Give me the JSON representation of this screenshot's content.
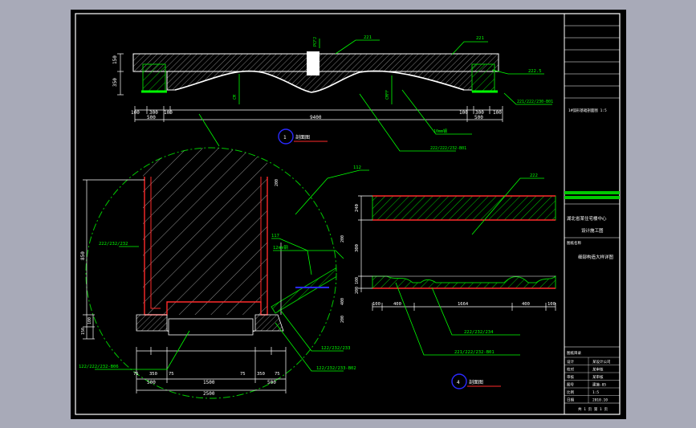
{
  "drawing": {
    "background": "#000000",
    "colors": {
      "border": "#ffffff",
      "dim": "#ffffff",
      "leader": "#00ff00",
      "wall": "#ff2a2a",
      "section_line": "#ff2a2a",
      "hatch_green": "#00c800",
      "hatch_white": "#bbbbbb",
      "blue_mark": "#2a2aff",
      "center_line": "#00c800"
    },
    "elevation": {
      "leader_labels": [
        "221",
        "221",
        "222.5",
        "PCFJ",
        "221/222/230-B01",
        "CM",
        "10mm钢",
        "CMFF",
        "222/222/232-B01"
      ],
      "dims_bottom": [
        "100",
        "300",
        "100",
        "100",
        "300",
        "100"
      ],
      "dims_bottom2": [
        "500",
        "9400",
        "500"
      ],
      "dims_left": [
        "150",
        "350"
      ],
      "title_number": "1",
      "title_text": "剖面图"
    },
    "detail": {
      "leader_labels": [
        "112",
        "117",
        "12mm钢",
        "122/232/233",
        "122/232/233-B02",
        "122/222/232-B06"
      ],
      "dims_left": [
        "850",
        "100",
        "150"
      ],
      "dims_right": [
        "200",
        "200",
        "400",
        "200"
      ],
      "dims_bottom": [
        "75",
        "350",
        "75",
        "75",
        "350",
        "75"
      ],
      "dims_bottom2": [
        "500",
        "1500",
        "500"
      ],
      "dims_bottom3": [
        "2500"
      ],
      "left_label": "222/232/232"
    },
    "section": {
      "leader_labels": [
        "222",
        "222/232/234",
        "221/222/232-B01"
      ],
      "dims_left": [
        "240",
        "300",
        "100",
        "200"
      ],
      "dims_bottom": [
        "100",
        "400",
        "1664",
        "400",
        "100"
      ],
      "title_number": "4",
      "title_text": "剖面图"
    },
    "title_block": {
      "note_small": "1#弧形基础剖面图 1:5",
      "project_name": "湖北省某住宅楼中心",
      "project_sub": "设计施工图",
      "drawing_no_label": "图纸名称",
      "drawing_name": "细部构造大样详图",
      "sheet_label": "图纸目录",
      "rows": [
        [
          "设计",
          "某设计公司"
        ],
        [
          "校对",
          "某审核"
        ],
        [
          "审核",
          "某审核"
        ],
        [
          "图号",
          "建施-05"
        ],
        [
          "比例",
          "1:5"
        ],
        [
          "日期",
          "2010.10"
        ]
      ],
      "footer": "共 1 页 第 1 页"
    }
  }
}
